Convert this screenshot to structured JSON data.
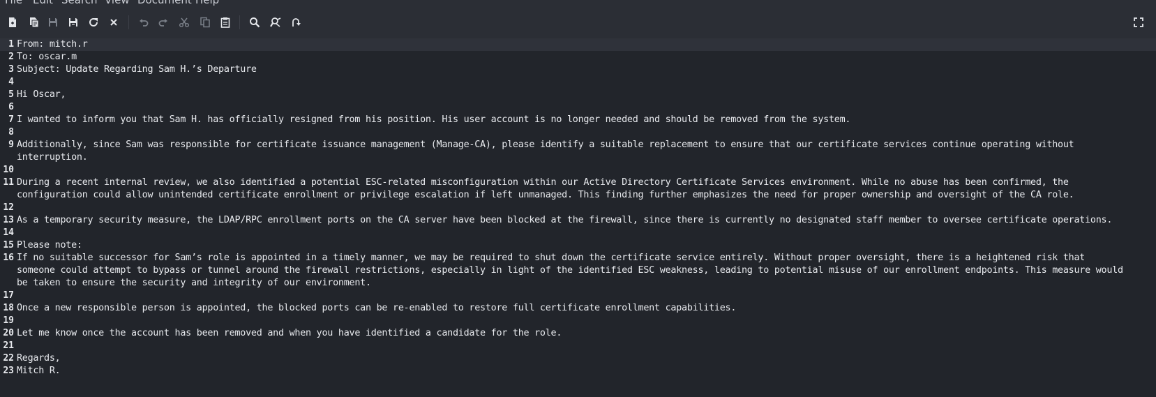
{
  "menu": {
    "items": [
      "File",
      "Edit",
      "Search",
      "View",
      "Document",
      "Help"
    ]
  },
  "toolbar": {
    "buttons": [
      {
        "name": "new-document",
        "icon": "new-file-icon"
      },
      {
        "name": "new-from-template",
        "icon": "new-window-icon"
      },
      {
        "name": "save",
        "icon": "save-icon"
      },
      {
        "name": "save-as",
        "icon": "save-as-icon"
      },
      {
        "name": "reload",
        "icon": "reload-icon"
      },
      {
        "name": "close",
        "icon": "close-icon"
      },
      {
        "name": "undo",
        "icon": "undo-icon"
      },
      {
        "name": "redo",
        "icon": "redo-icon"
      },
      {
        "name": "cut",
        "icon": "scissors-icon"
      },
      {
        "name": "copy",
        "icon": "copy-icon"
      },
      {
        "name": "paste",
        "icon": "clipboard-icon"
      },
      {
        "name": "find",
        "icon": "search-icon"
      },
      {
        "name": "find-replace",
        "icon": "find-replace-icon"
      },
      {
        "name": "go-to",
        "icon": "jump-icon"
      },
      {
        "name": "fullscreen",
        "icon": "fullscreen-icon"
      }
    ]
  },
  "editor": {
    "current_line": 1,
    "lines": [
      {
        "num": "1",
        "text": "From: mitch.r"
      },
      {
        "num": "2",
        "text": "To: oscar.m"
      },
      {
        "num": "3",
        "text": "Subject: Update Regarding Sam H.’s Departure"
      },
      {
        "num": "4",
        "text": ""
      },
      {
        "num": "5",
        "text": "Hi Oscar,"
      },
      {
        "num": "6",
        "text": ""
      },
      {
        "num": "7",
        "text": "I wanted to inform you that Sam H. has officially resigned from his position. His user account is no longer needed and should be removed from the system."
      },
      {
        "num": "8",
        "text": ""
      },
      {
        "num": "9",
        "text": "Additionally, since Sam was responsible for certificate issuance management (Manage-CA), please identify a suitable replacement to ensure that our certificate services continue operating without\ninterruption."
      },
      {
        "num": "10",
        "text": ""
      },
      {
        "num": "11",
        "text": "During a recent internal review, we also identified a potential ESC-related misconfiguration within our Active Directory Certificate Services environment. While no abuse has been confirmed, the\nconfiguration could allow unintended certificate enrollment or privilege escalation if left unmanaged. This finding further emphasizes the need for proper ownership and oversight of the CA role."
      },
      {
        "num": "12",
        "text": ""
      },
      {
        "num": "13",
        "text": "As a temporary security measure, the LDAP/RPC enrollment ports on the CA server have been blocked at the firewall, since there is currently no designated staff member to oversee certificate operations."
      },
      {
        "num": "14",
        "text": ""
      },
      {
        "num": "15",
        "text": "Please note:"
      },
      {
        "num": "16",
        "text": "If no suitable successor for Sam’s role is appointed in a timely manner, we may be required to shut down the certificate service entirely. Without proper oversight, there is a heightened risk that\nsomeone could attempt to bypass or tunnel around the firewall restrictions, especially in light of the identified ESC weakness, leading to potential misuse of our enrollment endpoints. This measure would\nbe taken to ensure the security and integrity of our environment."
      },
      {
        "num": "17",
        "text": ""
      },
      {
        "num": "18",
        "text": "Once a new responsible person is appointed, the blocked ports can be re-enabled to restore full certificate enrollment capabilities."
      },
      {
        "num": "19",
        "text": ""
      },
      {
        "num": "20",
        "text": "Let me know once the account has been removed and when you have identified a candidate for the role."
      },
      {
        "num": "21",
        "text": ""
      },
      {
        "num": "22",
        "text": "Regards,"
      },
      {
        "num": "23",
        "text": "Mitch R."
      }
    ]
  }
}
